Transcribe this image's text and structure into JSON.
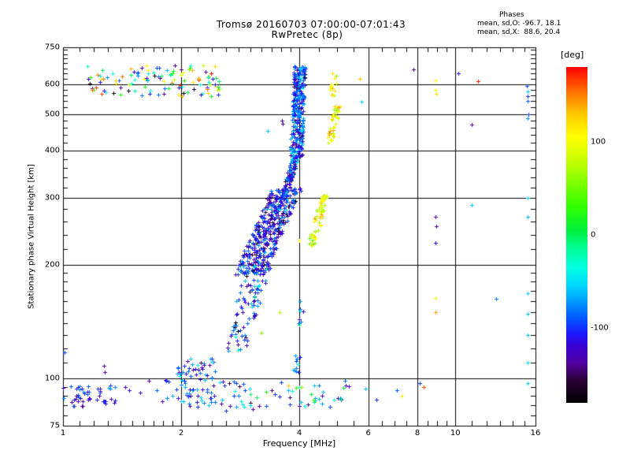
{
  "header": {
    "title_line1": "Tromsø 20160703 07:00:00-07:01:43",
    "title_line2": "RwPretec (8p)",
    "phases_title": "Phases",
    "phases_o": "mean, sd,O: -96.7, 18.1",
    "phases_x": "mean, sd,X:  88.6, 20.4"
  },
  "chart_data": {
    "type": "scatter",
    "title": "Tromsø 20160703 07:00:00-07:01:43 / RwPretec (8p)",
    "xlabel": "Frequency [MHz]",
    "ylabel": "Stationary phase Virtual Height [km]",
    "xscale": "log",
    "yscale": "log",
    "xlim": [
      1,
      16
    ],
    "ylim": [
      75,
      750
    ],
    "grid": true,
    "x_gridlines": [
      2,
      4,
      6,
      8,
      10
    ],
    "y_gridlines": [
      100,
      200,
      300,
      400,
      500,
      600
    ],
    "x_major_ticks": [
      {
        "v": 1,
        "label": "1"
      },
      {
        "v": 2,
        "label": "2"
      },
      {
        "v": 4,
        "label": "4"
      },
      {
        "v": 6,
        "label": "6"
      },
      {
        "v": 8,
        "label": "8"
      },
      {
        "v": 10,
        "label": "10"
      },
      {
        "v": 16,
        "label": "16"
      }
    ],
    "x_minor_ticks": [
      1.1,
      1.2,
      1.3,
      1.4,
      1.5,
      1.6,
      1.7,
      1.8,
      1.9,
      2.2,
      2.4,
      2.6,
      2.8,
      3.0,
      3.2,
      3.4,
      3.6,
      3.8,
      4.5,
      5.0,
      5.5,
      6.5,
      7.0,
      7.5,
      8.5,
      9.0,
      9.5,
      11,
      12,
      13,
      14,
      15
    ],
    "y_major_ticks": [
      {
        "v": 75,
        "label": "75"
      },
      {
        "v": 100,
        "label": "100"
      },
      {
        "v": 200,
        "label": "200"
      },
      {
        "v": 300,
        "label": "300"
      },
      {
        "v": 400,
        "label": "400"
      },
      {
        "v": 500,
        "label": "500"
      },
      {
        "v": 600,
        "label": "600"
      },
      {
        "v": 750,
        "label": "750"
      }
    ],
    "y_minor_ticks": [
      80,
      85,
      90,
      95,
      110,
      120,
      130,
      140,
      150,
      160,
      170,
      180,
      190,
      220,
      240,
      260,
      280,
      320,
      340,
      360,
      380,
      420,
      440,
      460,
      480,
      520,
      540,
      560,
      580,
      620,
      640,
      660,
      680,
      700,
      720,
      740
    ],
    "colorbar": {
      "title": "[deg]",
      "min": -180,
      "max": 180,
      "ticks": [
        {
          "v": 100,
          "label": "100"
        },
        {
          "v": 0,
          "label": "0"
        },
        {
          "v": -100,
          "label": "-100"
        }
      ]
    },
    "colormap": [
      [
        -180,
        "#000000"
      ],
      [
        -155,
        "#2b0038"
      ],
      [
        -138,
        "#5200a0"
      ],
      [
        -120,
        "#3a00d0"
      ],
      [
        -105,
        "#1a1aff"
      ],
      [
        -90,
        "#0055ff"
      ],
      [
        -70,
        "#00a0ff"
      ],
      [
        -55,
        "#00d4ff"
      ],
      [
        -35,
        "#00ffe0"
      ],
      [
        -15,
        "#00ff99"
      ],
      [
        5,
        "#00f03c"
      ],
      [
        30,
        "#30ff00"
      ],
      [
        60,
        "#8cff00"
      ],
      [
        85,
        "#d4ff00"
      ],
      [
        105,
        "#ffff00"
      ],
      [
        130,
        "#ffc800"
      ],
      [
        155,
        "#ff6a00"
      ],
      [
        175,
        "#ff1500"
      ],
      [
        180,
        "#ff0000"
      ]
    ],
    "seed": 20160703,
    "clusters": [
      {
        "name": "top-left-cloud",
        "n": 115,
        "f": [
          1.15,
          2.5
        ],
        "h": [
          556,
          672
        ],
        "corr": false,
        "fj": 0,
        "deg_range": [
          -180,
          180
        ]
      },
      {
        "name": "o-trace-upper",
        "n": 330,
        "f": [
          3.93,
          4.02
        ],
        "h": [
          385,
          668
        ],
        "corr": true,
        "fj": 0.035,
        "deg": [
          -95,
          28
        ]
      },
      {
        "name": "o-trace-bend",
        "n": 130,
        "f": [
          3.62,
          3.93
        ],
        "h": [
          295,
          390
        ],
        "corr": true,
        "fj": 0.02,
        "deg": [
          -100,
          30
        ]
      },
      {
        "name": "f-region-blob",
        "n": 420,
        "f": [
          3.0,
          3.72
        ],
        "h": [
          188,
          318
        ],
        "corr": true,
        "fj": 0.09,
        "deg": [
          -110,
          26
        ]
      },
      {
        "name": "lower-diagonal",
        "n": 90,
        "f": [
          2.72,
          3.15
        ],
        "h": [
          118,
          196
        ],
        "corr": true,
        "fj": 0.07,
        "deg": [
          -95,
          35
        ]
      },
      {
        "name": "spur-below-trace",
        "n": 18,
        "f": [
          3.9,
          4.12
        ],
        "h": [
          103,
          168
        ],
        "corr": true,
        "fj": 0.02,
        "deg": [
          -75,
          30
        ]
      },
      {
        "name": "es-band-left",
        "n": 48,
        "f": [
          1.0,
          1.38
        ],
        "h": [
          84,
          96
        ],
        "corr": false,
        "fj": 0,
        "deg": [
          -100,
          18
        ]
      },
      {
        "name": "es-sparse",
        "n": 12,
        "f": [
          1.4,
          1.95
        ],
        "h": [
          87,
          99
        ],
        "corr": false,
        "fj": 0,
        "deg": [
          -105,
          25
        ]
      },
      {
        "name": "es-clump-2mhz",
        "n": 75,
        "f": [
          1.95,
          2.45
        ],
        "h": [
          84,
          113
        ],
        "corr": false,
        "fj": 0,
        "deg": [
          -95,
          28
        ]
      },
      {
        "name": "es-band-mid",
        "n": 60,
        "f": [
          2.5,
          5.4
        ],
        "h": [
          84,
          99
        ],
        "corr": false,
        "fj": 0,
        "deg": [
          -85,
          45
        ]
      },
      {
        "name": "x-trace-blob",
        "n": 65,
        "f": [
          4.3,
          4.62
        ],
        "h": [
          224,
          305
        ],
        "corr": true,
        "fj": 0.025,
        "deg": [
          95,
          25
        ]
      },
      {
        "name": "x-trace-mid",
        "n": 40,
        "f": [
          4.78,
          5.0
        ],
        "h": [
          420,
          530
        ],
        "corr": true,
        "fj": 0.02,
        "deg": [
          100,
          28
        ]
      },
      {
        "name": "x-trace-upper",
        "n": 14,
        "f": [
          4.82,
          4.95
        ],
        "h": [
          545,
          645
        ],
        "corr": true,
        "fj": 0.02,
        "deg": [
          105,
          30
        ]
      }
    ],
    "points": [
      [
        5.7,
        618,
        130
      ],
      [
        5.75,
        538,
        -55
      ],
      [
        7.8,
        655,
        -145
      ],
      [
        8.9,
        612,
        100
      ],
      [
        10.15,
        640,
        -110
      ],
      [
        11.4,
        610,
        175
      ],
      [
        8.9,
        578,
        95
      ],
      [
        8.95,
        565,
        115
      ],
      [
        15.2,
        592,
        -95
      ],
      [
        15.3,
        572,
        -60
      ],
      [
        15.25,
        556,
        -100
      ],
      [
        15.3,
        540,
        -85
      ],
      [
        15.35,
        500,
        -95
      ],
      [
        15.3,
        488,
        -75
      ],
      [
        11.0,
        468,
        -135
      ],
      [
        11.0,
        288,
        -60
      ],
      [
        15.3,
        300,
        -55
      ],
      [
        15.3,
        268,
        -62
      ],
      [
        8.9,
        268,
        -130
      ],
      [
        8.92,
        252,
        -142
      ],
      [
        8.9,
        228,
        -115
      ],
      [
        8.9,
        163,
        95
      ],
      [
        8.9,
        150,
        140
      ],
      [
        12.7,
        162,
        -80
      ],
      [
        15.3,
        168,
        -55
      ],
      [
        15.3,
        148,
        -58
      ],
      [
        15.3,
        130,
        -60
      ],
      [
        15.3,
        110,
        -52
      ],
      [
        15.3,
        97,
        -55
      ],
      [
        7.1,
        93,
        -90
      ],
      [
        7.3,
        90,
        110
      ],
      [
        8.1,
        97,
        -95
      ],
      [
        8.3,
        95,
        165
      ],
      [
        5.9,
        94,
        -60
      ],
      [
        6.3,
        88,
        -100
      ],
      [
        1.27,
        108,
        -140
      ],
      [
        1.28,
        104,
        -135
      ],
      [
        1.01,
        117,
        -95
      ],
      [
        4.05,
        95,
        60
      ],
      [
        4.6,
        92,
        -60
      ],
      [
        3.05,
        83,
        -140
      ],
      [
        2.6,
        82,
        -100
      ],
      [
        3.75,
        96,
        130
      ],
      [
        4.35,
        88,
        40
      ],
      [
        3.3,
        92,
        20
      ],
      [
        3.61,
        480,
        -140
      ],
      [
        3.63,
        472,
        -142
      ],
      [
        3.32,
        452,
        -60
      ],
      [
        4.0,
        232,
        100
      ],
      [
        3.2,
        132,
        55
      ],
      [
        3.56,
        150,
        75
      ]
    ]
  }
}
